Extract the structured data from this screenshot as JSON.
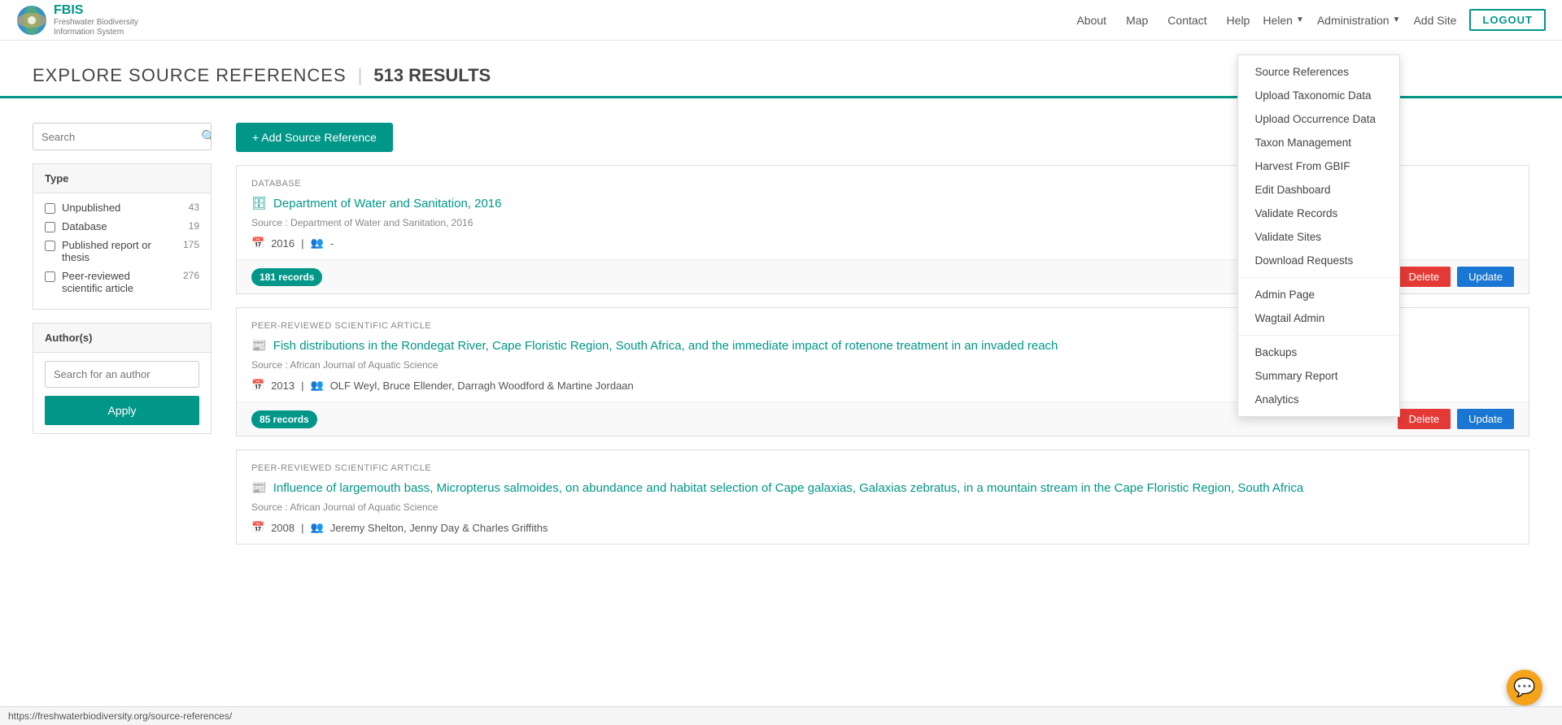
{
  "brand": {
    "logo_alt": "FBIS Logo",
    "name": "FBIS",
    "tagline_line1": "Freshwater Biodiversity",
    "tagline_line2": "Information System"
  },
  "navbar": {
    "links": [
      "About",
      "Map",
      "Contact",
      "Help"
    ],
    "user": "Helen",
    "admin_label": "Administration",
    "add_site": "Add Site",
    "logout": "LOGOUT"
  },
  "admin_menu": {
    "items": [
      "Source References",
      "Upload Taxonomic Data",
      "Upload Occurrence Data",
      "Taxon Management",
      "Harvest From GBIF",
      "Edit Dashboard",
      "Validate Records",
      "Validate Sites",
      "Download Requests"
    ],
    "items2": [
      "Admin Page",
      "Wagtail Admin"
    ],
    "items3": [
      "Backups",
      "Summary Report",
      "Analytics"
    ]
  },
  "page": {
    "title": "EXPLORE SOURCE REFERENCES",
    "results_count": "513 RESULTS"
  },
  "sidebar": {
    "search_placeholder": "Search",
    "type_section": "Type",
    "filters": [
      {
        "label": "Unpublished",
        "count": "43"
      },
      {
        "label": "Database",
        "count": "19"
      },
      {
        "label": "Published report or thesis",
        "count": "175"
      },
      {
        "label": "Peer-reviewed scientific article",
        "count": "276"
      }
    ],
    "authors_section": "Author(s)",
    "author_placeholder": "Search for an author",
    "apply_label": "Apply"
  },
  "add_source_btn": "+ Add Source Reference",
  "references": [
    {
      "type": "DATABASE",
      "title": "Department of Water and Sanitation, 2016",
      "icon": "🗄",
      "source": "Source : Department of Water and Sanitation, 2016",
      "year": "2016",
      "authors": "-",
      "records": "181 records"
    },
    {
      "type": "PEER-REVIEWED SCIENTIFIC ARTICLE",
      "title": "Fish distributions in the Rondegat River, Cape Floristic Region, South Africa, and the immediate impact of rotenone treatment in an invaded reach",
      "icon": "📰",
      "source": "Source : African Journal of Aquatic Science",
      "year": "2013",
      "authors": "OLF Weyl, Bruce Ellender, Darragh Woodford & Martine Jordaan",
      "records": "85 records"
    },
    {
      "type": "PEER-REVIEWED SCIENTIFIC ARTICLE",
      "title": "Influence of largemouth bass, Micropterus salmoides, on abundance and habitat selection of Cape galaxias, Galaxias zebratus, in a mountain stream in the Cape Floristic Region, South Africa",
      "icon": "📰",
      "source": "Source : African Journal of Aquatic Science",
      "year": "2008",
      "authors": "Jeremy Shelton, Jenny Day & Charles Griffiths",
      "records": null
    }
  ],
  "status_bar": {
    "url": "https://freshwaterbiodiversity.org/source-references/"
  }
}
